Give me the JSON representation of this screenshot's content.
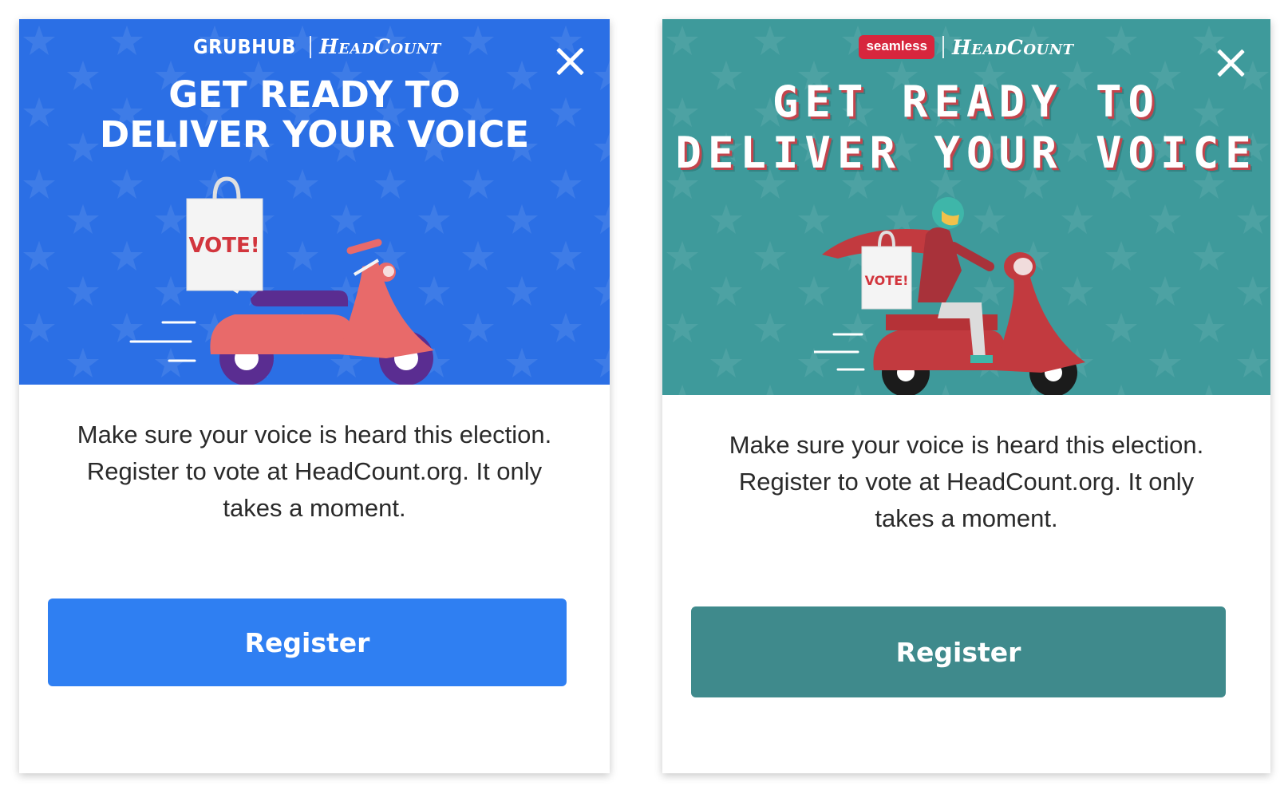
{
  "grubhub_card": {
    "brand_name": "GRUBHUB",
    "partner_name": "HeadCount",
    "headline_line1": "GET READY TO",
    "headline_line2": "DELIVER YOUR VOICE",
    "bag_text": "VOTE!",
    "body_text": "Make sure your voice is heard this election. Register to vote at HeadCount.org. It only takes a moment.",
    "register_label": "Register",
    "colors": {
      "hero": "#2b6fe5",
      "button": "#2f7ff2",
      "scooter": "#e86a6a"
    },
    "close_icon": "close-icon"
  },
  "seamless_card": {
    "brand_name": "seamless",
    "partner_name": "HeadCount",
    "headline_line1": "GET READY TO",
    "headline_line2": "DELIVER YOUR VOICE",
    "bag_text": "VOTE!",
    "body_text": "Make sure your voice is heard this election. Register to vote at HeadCount.org. It only takes a moment.",
    "register_label": "Register",
    "colors": {
      "hero": "#3e9a9b",
      "button": "#3f8a8c",
      "scooter": "#c23a3f",
      "brand_badge": "#d7263d"
    },
    "close_icon": "close-icon"
  }
}
